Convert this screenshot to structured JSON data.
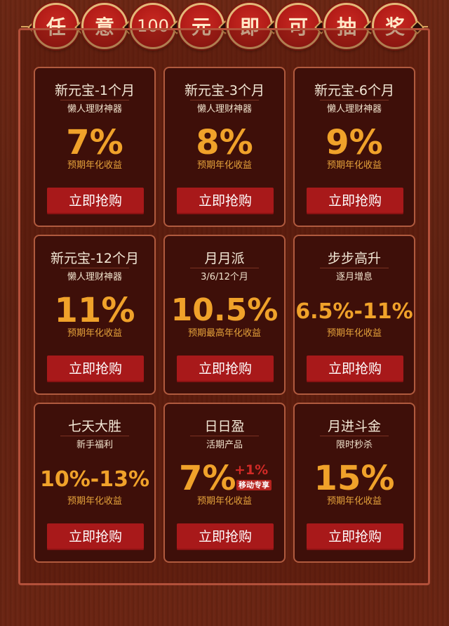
{
  "banner": {
    "characters": [
      "任",
      "意",
      "100",
      "元",
      "即",
      "可",
      "抽",
      "奖"
    ]
  },
  "products": [
    {
      "title": "新元宝-1个月",
      "subtitle": "懒人理财神器",
      "rate": "7%",
      "rate_label": "预期年化收益",
      "button": "立即抢购"
    },
    {
      "title": "新元宝-3个月",
      "subtitle": "懒人理财神器",
      "rate": "8%",
      "rate_label": "预期年化收益",
      "button": "立即抢购"
    },
    {
      "title": "新元宝-6个月",
      "subtitle": "懒人理财神器",
      "rate": "9%",
      "rate_label": "预期年化收益",
      "button": "立即抢购"
    },
    {
      "title": "新元宝-12个月",
      "subtitle": "懒人理财神器",
      "rate": "11%",
      "rate_label": "预期年化收益",
      "button": "立即抢购"
    },
    {
      "title": "月月派",
      "subtitle": "3/6/12个月",
      "rate": "10.5%",
      "rate_label": "预期最高年化收益",
      "button": "立即抢购"
    },
    {
      "title": "步步高升",
      "subtitle": "逐月增息",
      "rate": "6.5%-11%",
      "rate_label": "预期年化收益",
      "button": "立即抢购"
    },
    {
      "title": "七天大胜",
      "subtitle": "新手福利",
      "rate": "10%-13%",
      "rate_label": "预期年化收益",
      "button": "立即抢购"
    },
    {
      "title": "日日盈",
      "subtitle": "活期产品",
      "rate": "7%",
      "bonus": "+1%",
      "bonus_tag": "移动专享",
      "rate_label": "预期年化收益",
      "button": "立即抢购"
    },
    {
      "title": "月进斗金",
      "subtitle": "限时秒杀",
      "rate": "15%",
      "rate_label": "预期年化收益",
      "button": "立即抢购"
    }
  ],
  "colors": {
    "background": "#6a2512",
    "card": "#3e0f09",
    "rate": "#f0a22a",
    "button": "#a8191a",
    "coin": "#b31c18"
  }
}
